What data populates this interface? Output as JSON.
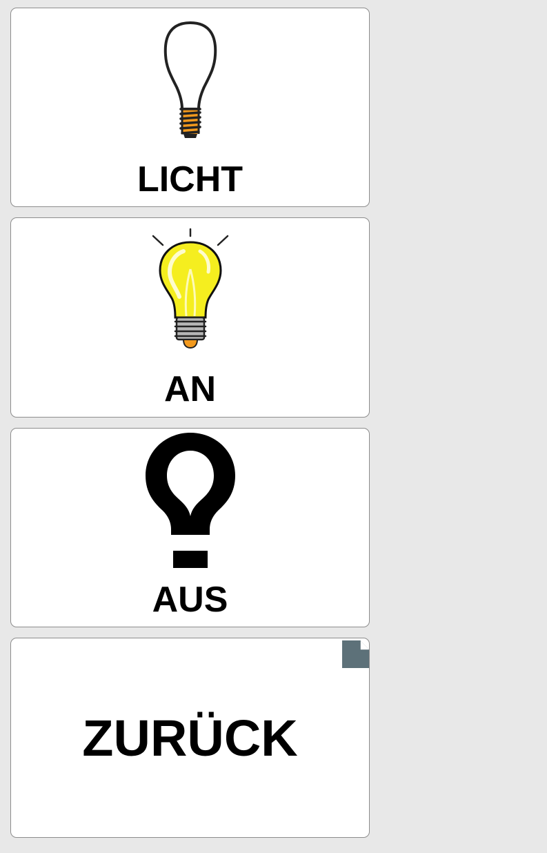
{
  "cells": [
    {
      "label": "LICHT",
      "icon": "lightbulb-outline-icon"
    },
    {
      "label": "AN",
      "icon": "lightbulb-on-icon"
    },
    {
      "label": "AUS",
      "icon": "lightbulb-off-icon"
    },
    {
      "label": "ZURÜCK",
      "icon": "page-corner-icon"
    }
  ],
  "colors": {
    "background": "#e8e8e8",
    "cell_background": "#ffffff",
    "cell_border": "#8c8c8c",
    "bulb_on": "#f5ee1f",
    "bulb_base": "#f39a1e",
    "page_icon": "#5d7179"
  }
}
